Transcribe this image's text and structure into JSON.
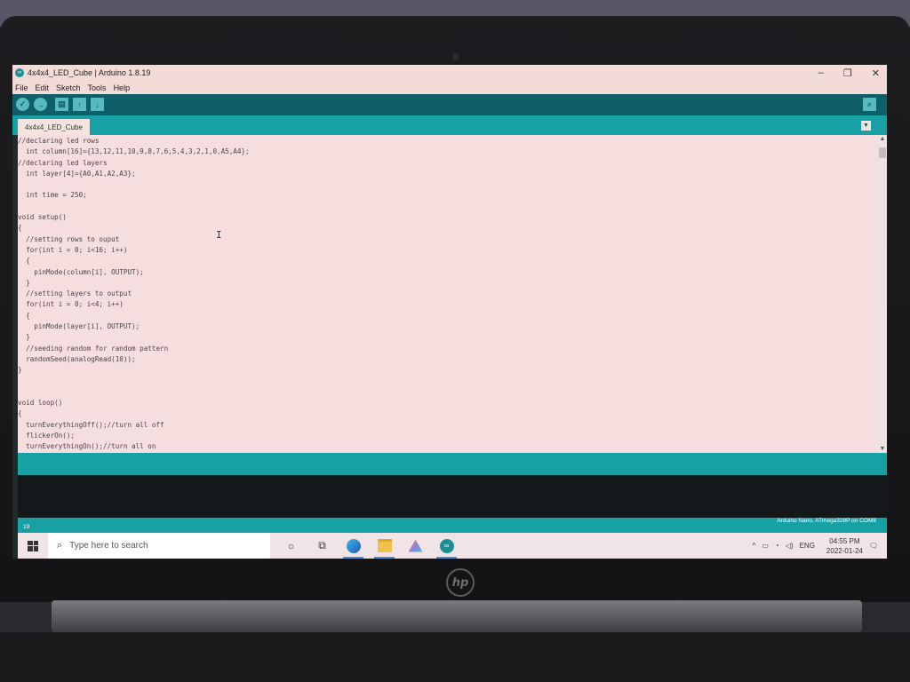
{
  "window": {
    "title": "4x4x4_LED_Cube | Arduino 1.8.19"
  },
  "menu": [
    "File",
    "Edit",
    "Sketch",
    "Tools",
    "Help"
  ],
  "tab": {
    "name": "4x4x4_LED_Cube"
  },
  "code": [
    "//declaring led rows",
    "  int column[16]={13,12,11,10,9,8,7,6,5,4,3,2,1,0,A5,A4};",
    "//declaring led layers",
    "  int layer[4]={A0,A1,A2,A3};",
    "",
    "  int time = 250;",
    "",
    "void setup()",
    "{",
    "  //setting rows to ouput",
    "  for(int i = 0; i<16; i++)",
    "  {",
    "    pinMode(column[i], OUTPUT);",
    "  }",
    "  //setting layers to output",
    "  for(int i = 0; i<4; i++)",
    "  {",
    "    pinMode(layer[i], OUTPUT);",
    "  }",
    "  //seeding random for random pattern",
    "  randomSeed(analogRead(10));",
    "}",
    "",
    "",
    "void loop()",
    "{",
    "  turnEverythingOff();//turn all off",
    "  flickerOn();",
    "  turnEverythingOn();//turn all on"
  ],
  "status": {
    "line_number": "19",
    "board": "Arduino Nano, ATmega328P on COM8"
  },
  "taskbar": {
    "search_placeholder": "Type here to search",
    "language": "ENG",
    "time": "04:55 PM",
    "date": "2022-01-24"
  },
  "icons": {
    "verify": "check-icon",
    "upload": "arrow-right-icon",
    "new": "new-file-icon",
    "open": "arrow-up-icon",
    "save": "arrow-down-icon",
    "serial_monitor": "magnifier-icon"
  },
  "colors": {
    "toolbar": "#0f5f68",
    "teal": "#17a1a5",
    "editor_bg": "#f7dede"
  }
}
